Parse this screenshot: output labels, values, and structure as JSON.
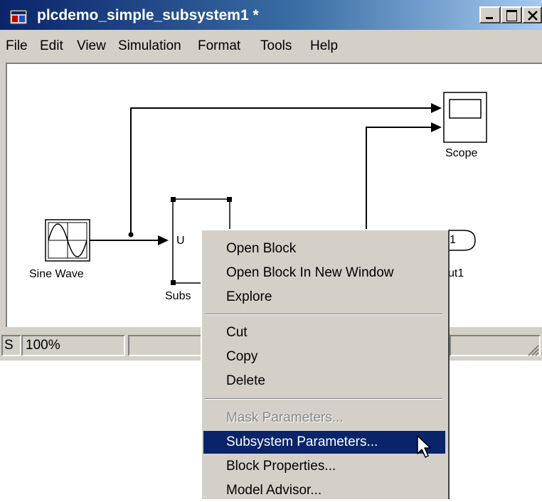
{
  "window": {
    "title": "plcdemo_simple_subsystem1 *"
  },
  "menu": [
    "File",
    "Edit",
    "View",
    "Simulation",
    "Format",
    "Tools",
    "Help"
  ],
  "diagram": {
    "blocks": {
      "sine": "Sine Wave",
      "subsystem": "Subs",
      "subsystem_port": "U",
      "scope": "Scope",
      "outport_number": "1",
      "outport_label": "ut1"
    }
  },
  "status": {
    "left": "S",
    "zoom": "100%"
  },
  "context_menu": {
    "group1": [
      "Open Block",
      "Open Block In New Window",
      "Explore"
    ],
    "group2": [
      "Cut",
      "Copy",
      "Delete"
    ],
    "group3": [
      "Mask Parameters...",
      "Subsystem Parameters...",
      "Block Properties...",
      "Model Advisor..."
    ],
    "disabled_item": "Mask Parameters...",
    "highlighted_item": "Subsystem Parameters..."
  },
  "colors": {
    "titlebar": "#0a246a",
    "highlight": "#0a246a",
    "face": "#d4d0c8"
  }
}
